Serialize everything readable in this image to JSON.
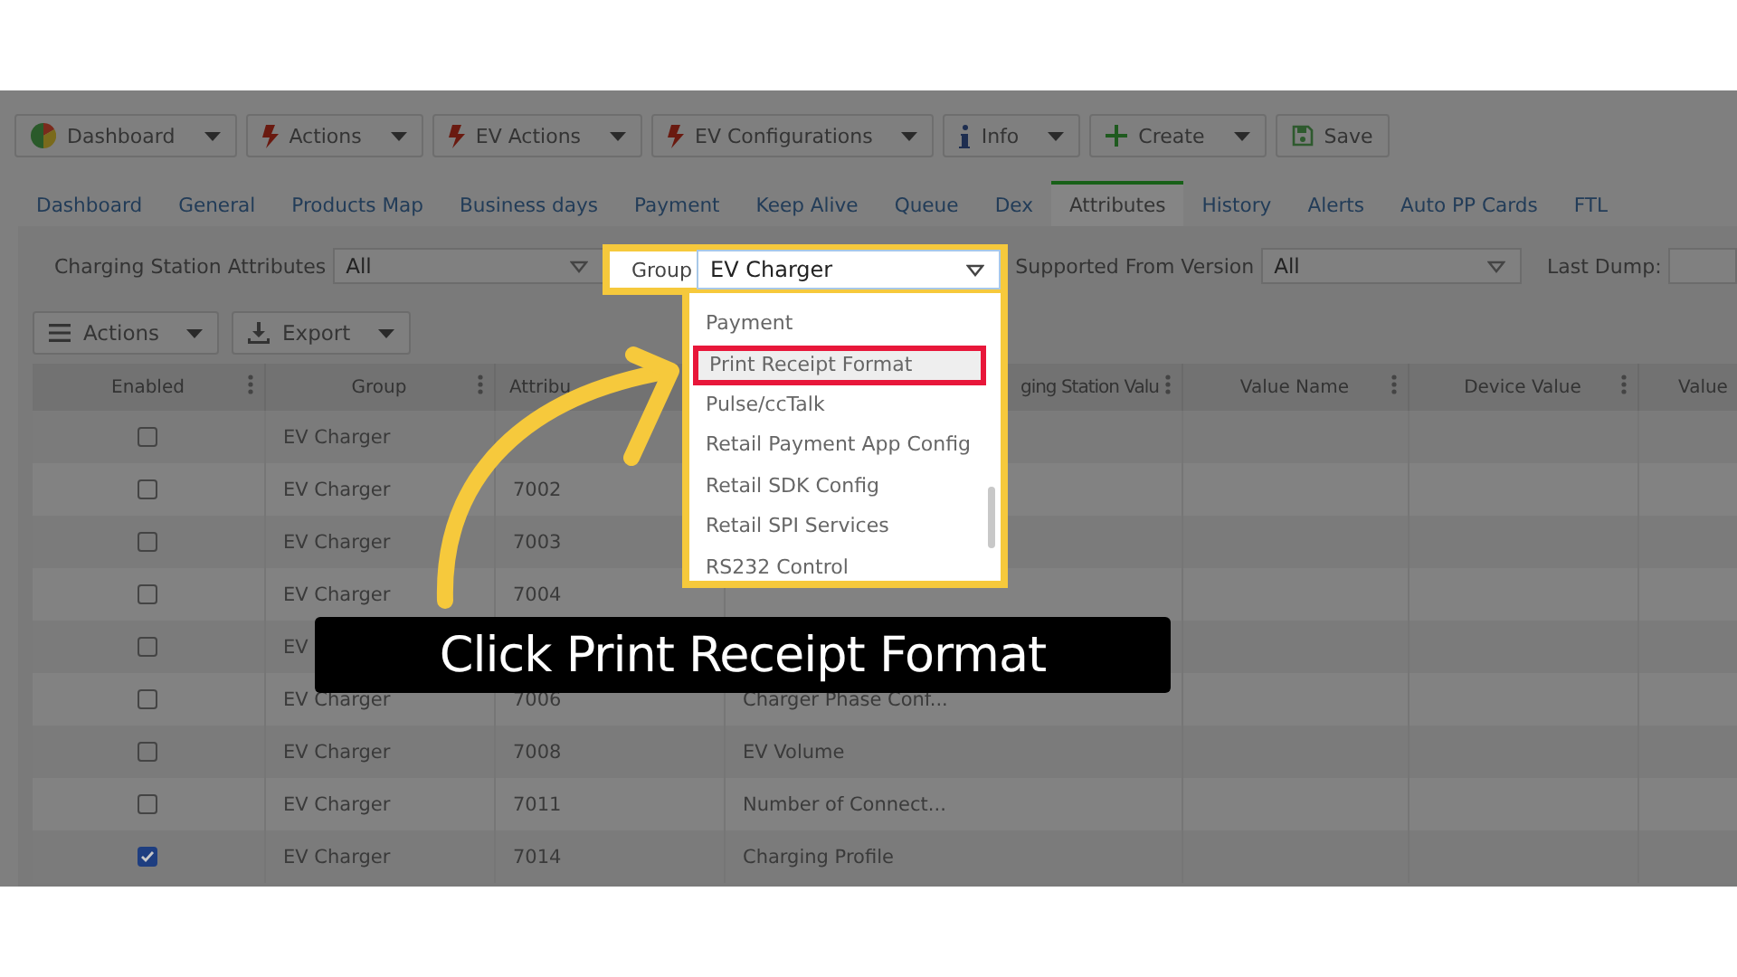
{
  "toolbar": [
    {
      "label": "Dashboard",
      "kind": "pie",
      "has_menu": true
    },
    {
      "label": "Actions",
      "kind": "bolt",
      "has_menu": true
    },
    {
      "label": "EV Actions",
      "kind": "bolt",
      "has_menu": true
    },
    {
      "label": "EV Configurations",
      "kind": "bolt",
      "has_menu": true
    },
    {
      "label": "Info",
      "kind": "info",
      "has_menu": true
    },
    {
      "label": "Create",
      "kind": "plus",
      "has_menu": true
    },
    {
      "label": "Save",
      "kind": "save",
      "has_menu": false
    }
  ],
  "tabs": [
    {
      "label": "Dashboard",
      "selected": false
    },
    {
      "label": "General",
      "selected": false
    },
    {
      "label": "Products Map",
      "selected": false
    },
    {
      "label": "Business days",
      "selected": false
    },
    {
      "label": "Payment",
      "selected": false
    },
    {
      "label": "Keep Alive",
      "selected": false
    },
    {
      "label": "Queue",
      "selected": false
    },
    {
      "label": "Dex",
      "selected": false
    },
    {
      "label": "Attributes",
      "selected": true
    },
    {
      "label": "History",
      "selected": false
    },
    {
      "label": "Alerts",
      "selected": false
    },
    {
      "label": "Auto PP Cards",
      "selected": false
    },
    {
      "label": "FTL",
      "selected": false
    }
  ],
  "filters": {
    "attributes_label": "Charging Station Attributes",
    "attributes_value": "All",
    "group_label": "Group",
    "group_value": "EV Charger",
    "version_label": "Supported From Version",
    "version_value": "All",
    "last_dump_label": "Last Dump:"
  },
  "grid_buttons": [
    {
      "label": "Actions",
      "kind": "menu"
    },
    {
      "label": "Export",
      "kind": "export"
    }
  ],
  "table": {
    "columns": [
      "Enabled",
      "Group",
      "Attribu",
      "ging Station Valu",
      "Value Name",
      "Device Value",
      "Value"
    ],
    "rows": [
      {
        "enabled": false,
        "group": "EV Charger",
        "attribute": "",
        "name": ""
      },
      {
        "enabled": false,
        "group": "EV Charger",
        "attribute": "7002",
        "name": ""
      },
      {
        "enabled": false,
        "group": "EV Charger",
        "attribute": "7003",
        "name": ""
      },
      {
        "enabled": false,
        "group": "EV Charger",
        "attribute": "7004",
        "name": ""
      },
      {
        "enabled": false,
        "group": "EV",
        "attribute": "",
        "name": ""
      },
      {
        "enabled": false,
        "group": "EV Charger",
        "attribute": "7006",
        "name": "Charger Phase Conf..."
      },
      {
        "enabled": false,
        "group": "EV Charger",
        "attribute": "7008",
        "name": "EV Volume"
      },
      {
        "enabled": false,
        "group": "EV Charger",
        "attribute": "7011",
        "name": "Number of Connect..."
      },
      {
        "enabled": true,
        "group": "EV Charger",
        "attribute": "7014",
        "name": "Charging Profile"
      }
    ]
  },
  "group_dropdown": [
    {
      "label": "Payment",
      "selected": false
    },
    {
      "label": "Print Receipt Format",
      "selected": true
    },
    {
      "label": "Pulse/ccTalk",
      "selected": false
    },
    {
      "label": "Retail Payment App Config",
      "selected": false
    },
    {
      "label": "Retail SDK Config",
      "selected": false
    },
    {
      "label": "Retail SPI Services",
      "selected": false
    },
    {
      "label": "RS232 Control",
      "selected": false
    }
  ],
  "callout": "Click Print Receipt Format"
}
